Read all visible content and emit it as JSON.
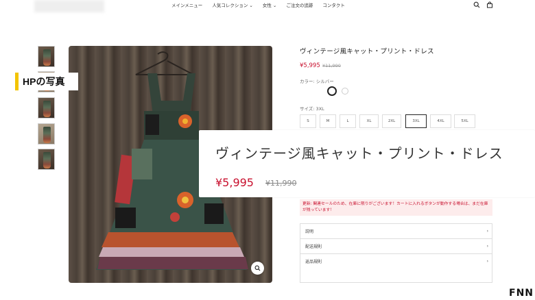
{
  "header": {
    "nav": [
      "メインメニュー",
      "人気コレクション ⌄",
      "女性 ⌄",
      "ご注文の追跡",
      "コンタクト"
    ]
  },
  "overlay_label": "HPの写真",
  "product": {
    "title": "ヴィンテージ風キャット・プリント・ドレス",
    "price": "¥5,995",
    "old_price": "¥11,990",
    "color_label": "カラー: シルバー",
    "size_label": "サイズ: 3XL",
    "sizes": [
      "S",
      "M",
      "L",
      "XL",
      "2XL",
      "3XL",
      "4XL",
      "5XL"
    ],
    "selected_size": "3XL",
    "notice": "更新: 関連セールのため、在庫に限りがございます！カートに入れるボタンが動作する場合は、まだ在庫が残っています！",
    "accordions": [
      "説明",
      "配送規則",
      "返品規則"
    ]
  },
  "zoom": {
    "title": "ヴィンテージ風キャット・プリント・ドレス",
    "price": "¥5,995",
    "old_price": "¥11,990"
  },
  "watermark": "FNN",
  "colors": {
    "price_red": "#c8102e",
    "label_accent": "#f3c400"
  },
  "icons": [
    "search-icon",
    "bag-icon",
    "zoom-icon"
  ]
}
